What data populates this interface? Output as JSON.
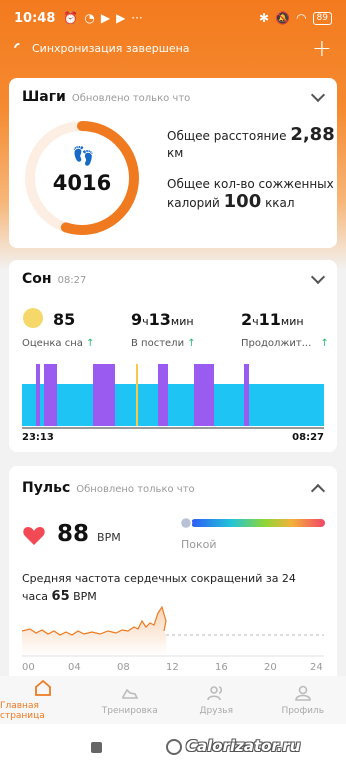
{
  "status": {
    "time": "10:48",
    "battery": "89"
  },
  "sync": {
    "text": "Синхронизация завершена",
    "plus": "+"
  },
  "steps": {
    "title": "Шаги",
    "subtitle": "Обновлено только что",
    "value": "4016",
    "progress": 0.55,
    "distance_label": "Общее расстояние",
    "distance_value": "2,88",
    "distance_unit": "км",
    "calories_label_1": "Общее кол-во сожженных",
    "calories_label_2": "калорий",
    "calories_value": "100",
    "calories_unit": "ккал"
  },
  "sleep": {
    "title": "Сон",
    "subtitle": "08:27",
    "score": "85",
    "score_label": "Оценка сна",
    "bed_h": "9",
    "bed_h_unit": "ч",
    "bed_m": "13",
    "bed_m_unit": "мин",
    "bed_label": "В постели",
    "dur_h": "2",
    "dur_h_unit": "ч",
    "dur_m": "11",
    "dur_m_unit": "мин",
    "dur_label": "Продолжит...",
    "up": "↑",
    "start": "23:13",
    "end": "08:27",
    "colors": {
      "light": "#1ec4f4",
      "rem": "#9a5cf0",
      "awake": "#f7c948"
    }
  },
  "pulse": {
    "title": "Пульс",
    "subtitle": "Обновлено только что",
    "value": "88",
    "unit": "BPM",
    "state": "Покой",
    "avg_text_1": "Средняя частота сердечных сокращений за 24",
    "avg_text_2": "часа",
    "avg_value": "65",
    "avg_unit": "BPM",
    "x_ticks": [
      "00",
      "04",
      "08",
      "12",
      "16",
      "20",
      "24"
    ]
  },
  "nav": {
    "home": "Главная страница",
    "workouts": "Тренировка",
    "friends": "Друзья",
    "profile": "Профиль"
  },
  "watermark": "Calorizator.ru",
  "accent": "#f07a20"
}
